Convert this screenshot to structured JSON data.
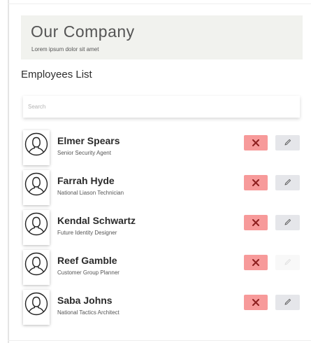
{
  "company": {
    "title": "Our Company",
    "tagline": "Lorem ipsum dolor sit amet"
  },
  "employees_section": {
    "title": "Employees List"
  },
  "search": {
    "placeholder": "Search",
    "value": ""
  },
  "employees": [
    {
      "name": "Elmer Spears",
      "role": "Senior Security Agent"
    },
    {
      "name": "Farrah Hyde",
      "role": "National Liason Technician"
    },
    {
      "name": "Kendal Schwartz",
      "role": "Future Identity Designer"
    },
    {
      "name": "Reef Gamble",
      "role": "Customer Group Planner"
    },
    {
      "name": "Saba Johns",
      "role": "National Tactics Architect"
    }
  ],
  "icons": {
    "avatar": "user-outline-icon",
    "delete": "close-x-icon",
    "edit": "pencil-icon"
  },
  "colors": {
    "header_bg": "#f1f2ee",
    "delete_button": "#f79a9a",
    "edit_button": "#e5e6ea"
  }
}
